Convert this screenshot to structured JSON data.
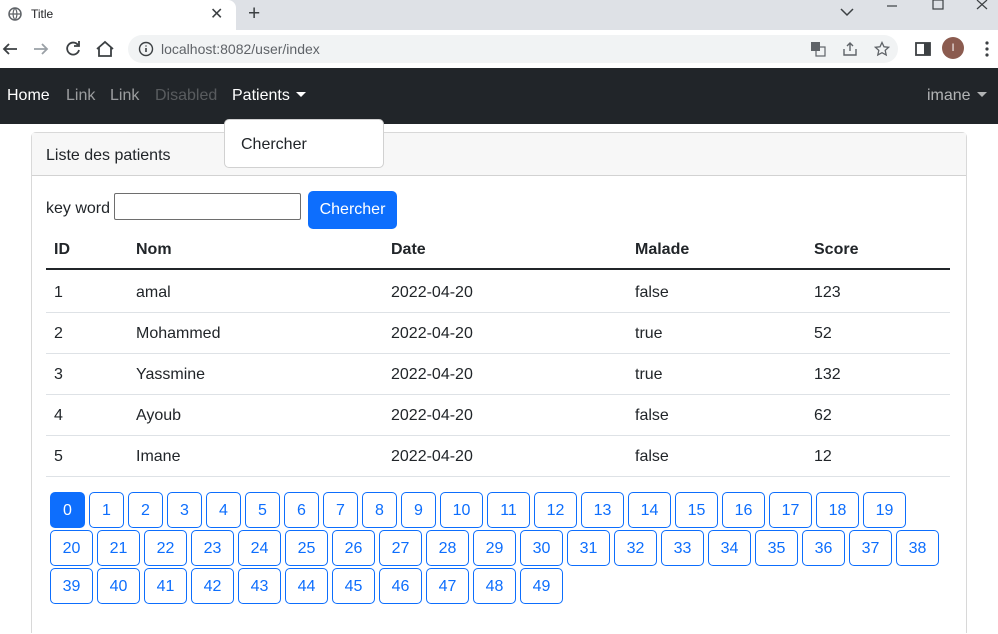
{
  "browser": {
    "tab_title": "Title",
    "url": "localhost:8082/user/index",
    "profile_initial": "I"
  },
  "navbar": {
    "home": "Home",
    "link1": "Link",
    "link2": "Link",
    "disabled": "Disabled",
    "patients": "Patients",
    "user": "imane"
  },
  "dropdown": {
    "item": "Chercher"
  },
  "card": {
    "header": "Liste des patients"
  },
  "search": {
    "label": "key word",
    "value": "",
    "button": "Chercher"
  },
  "table": {
    "headers": [
      "ID",
      "Nom",
      "Date",
      "Malade",
      "Score"
    ],
    "rows": [
      [
        "1",
        "amal",
        "2022-04-20",
        "false",
        "123"
      ],
      [
        "2",
        "Mohammed",
        "2022-04-20",
        "true",
        "52"
      ],
      [
        "3",
        "Yassmine",
        "2022-04-20",
        "true",
        "132"
      ],
      [
        "4",
        "Ayoub",
        "2022-04-20",
        "false",
        "62"
      ],
      [
        "5",
        "Imane",
        "2022-04-20",
        "false",
        "12"
      ]
    ]
  },
  "pagination": {
    "active": "0",
    "pages": [
      "0",
      "1",
      "2",
      "3",
      "4",
      "5",
      "6",
      "7",
      "8",
      "9",
      "10",
      "11",
      "12",
      "13",
      "14",
      "15",
      "16",
      "17",
      "18",
      "19",
      "20",
      "21",
      "22",
      "23",
      "24",
      "25",
      "26",
      "27",
      "28",
      "29",
      "30",
      "31",
      "32",
      "33",
      "34",
      "35",
      "36",
      "37",
      "38",
      "39",
      "40",
      "41",
      "42",
      "43",
      "44",
      "45",
      "46",
      "47",
      "48",
      "49"
    ]
  },
  "colors": {
    "primary": "#0d6efd",
    "navbar": "#212529"
  }
}
